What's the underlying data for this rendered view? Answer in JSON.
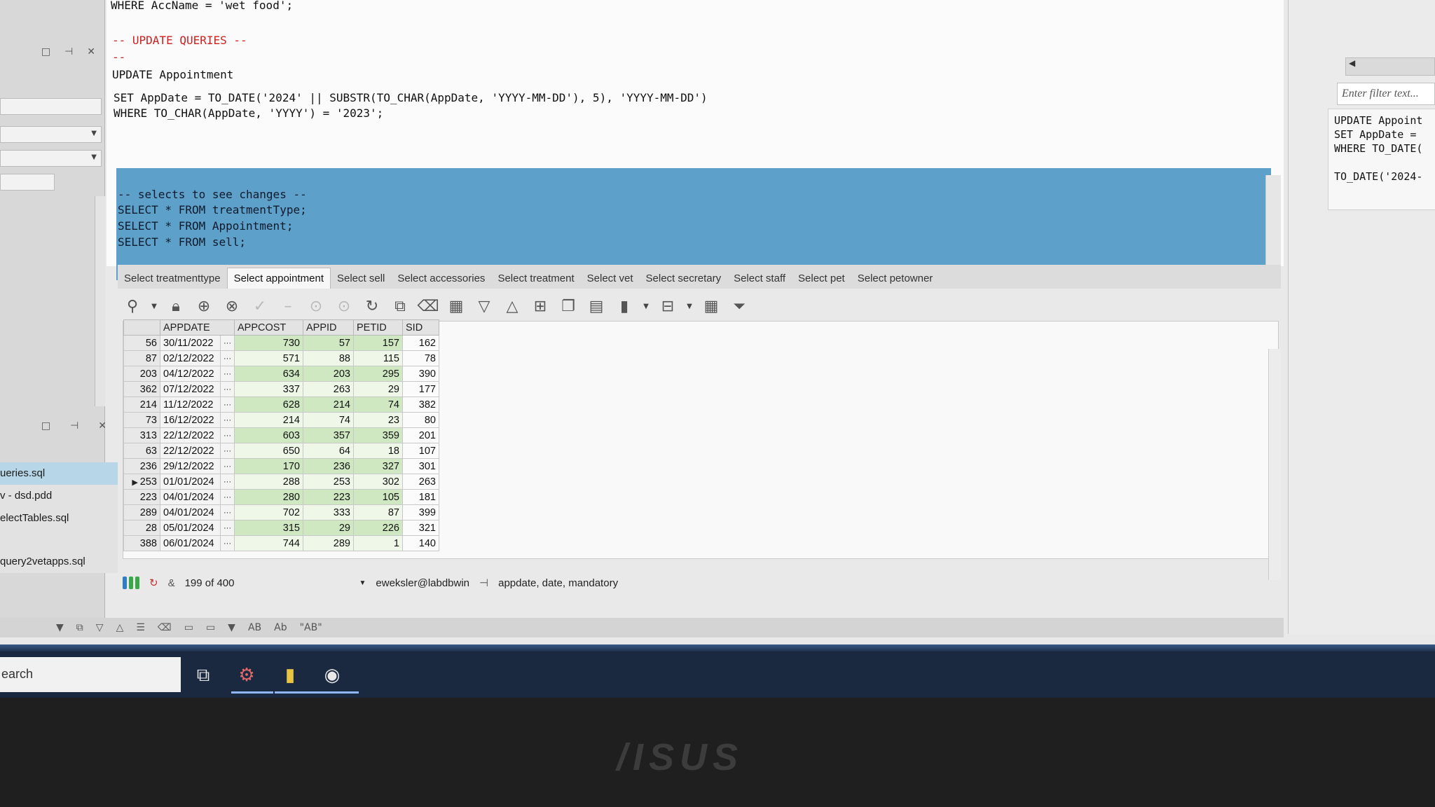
{
  "editor": {
    "lines": [
      "WHERE AccName = 'wet food';",
      "-- UPDATE QUERIES --",
      "--",
      "UPDATE Appointment",
      "SET AppDate = TO_DATE('2024' || SUBSTR(TO_CHAR(AppDate, 'YYYY-MM-DD'), 5), 'YYYY-MM-DD')",
      "WHERE TO_CHAR(AppDate, 'YYYY') = '2023';"
    ],
    "selected_lines": [
      "-- selects to see changes --",
      "SELECT * FROM treatmentType;",
      "SELECT * FROM Appointment;",
      "SELECT * FROM sell;"
    ]
  },
  "left_panel": {
    "files": [
      "ueries.sql",
      "v - dsd.pdd",
      "electTables.sql",
      "query2vetapps.sql"
    ],
    "active_file_index": 0
  },
  "tabs": [
    "Select treatmenttype",
    "Select appointment",
    "Select sell",
    "Select accessories",
    "Select treatment",
    "Select vet",
    "Select secretary",
    "Select staff",
    "Select pet",
    "Select petowner"
  ],
  "active_tab_index": 1,
  "grid": {
    "columns": [
      "APPDATE",
      "APPCOST",
      "APPID",
      "PETID",
      "SID"
    ],
    "rows": [
      {
        "rn": "56",
        "appdate": "30/11/2022",
        "appcost": "730",
        "appid": "57",
        "petid": "157",
        "sid": "162"
      },
      {
        "rn": "87",
        "appdate": "02/12/2022",
        "appcost": "571",
        "appid": "88",
        "petid": "115",
        "sid": "78"
      },
      {
        "rn": "203",
        "appdate": "04/12/2022",
        "appcost": "634",
        "appid": "203",
        "petid": "295",
        "sid": "390"
      },
      {
        "rn": "362",
        "appdate": "07/12/2022",
        "appcost": "337",
        "appid": "263",
        "petid": "29",
        "sid": "177"
      },
      {
        "rn": "214",
        "appdate": "11/12/2022",
        "appcost": "628",
        "appid": "214",
        "petid": "74",
        "sid": "382"
      },
      {
        "rn": "73",
        "appdate": "16/12/2022",
        "appcost": "214",
        "appid": "74",
        "petid": "23",
        "sid": "80"
      },
      {
        "rn": "313",
        "appdate": "22/12/2022",
        "appcost": "603",
        "appid": "357",
        "petid": "359",
        "sid": "201"
      },
      {
        "rn": "63",
        "appdate": "22/12/2022",
        "appcost": "650",
        "appid": "64",
        "petid": "18",
        "sid": "107"
      },
      {
        "rn": "236",
        "appdate": "29/12/2022",
        "appcost": "170",
        "appid": "236",
        "petid": "327",
        "sid": "301"
      },
      {
        "rn": "253",
        "appdate": "01/01/2024",
        "appcost": "288",
        "appid": "253",
        "petid": "302",
        "sid": "263"
      },
      {
        "rn": "223",
        "appdate": "04/01/2024",
        "appcost": "280",
        "appid": "223",
        "petid": "105",
        "sid": "181"
      },
      {
        "rn": "289",
        "appdate": "04/01/2024",
        "appcost": "702",
        "appid": "333",
        "petid": "87",
        "sid": "399"
      },
      {
        "rn": "28",
        "appdate": "05/01/2024",
        "appcost": "315",
        "appid": "29",
        "petid": "226",
        "sid": "321"
      },
      {
        "rn": "388",
        "appdate": "06/01/2024",
        "appcost": "744",
        "appid": "289",
        "petid": "1",
        "sid": "140"
      }
    ],
    "current_row_index": 9
  },
  "status": {
    "record_count": "199 of 400",
    "connection": "eweksler@labdbwin",
    "column_info": "appdate, date, mandatory"
  },
  "right_panel": {
    "filter_placeholder": "Enter filter text...",
    "code_lines": [
      "UPDATE Appoint",
      "SET AppDate =",
      "WHERE TO_DATE(",
      "",
      "TO_DATE('2024-"
    ]
  },
  "bottom_toolbar": {
    "labels": [
      "AB",
      "Ab",
      "\"AB\""
    ]
  },
  "taskbar": {
    "search_text": "earch"
  },
  "monitor": {
    "brand": "/ISUS"
  },
  "colors": {
    "selection": "#5da0c9",
    "string_blue": "#1b3fb5",
    "comment_red": "#d02020",
    "grid_green": "#cfe8c1"
  }
}
